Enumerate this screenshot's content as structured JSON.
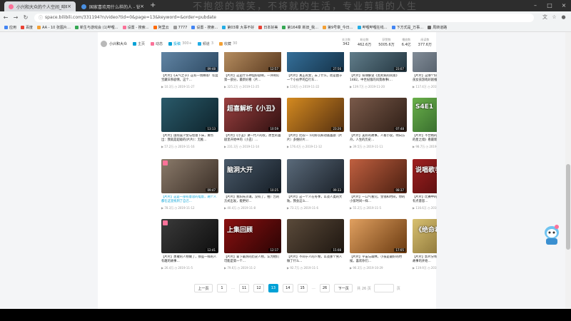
{
  "browser": {
    "tabs": [
      {
        "title": "小兴和大众的个人空间_哔哩哔哩",
        "active": true
      },
      {
        "title": "国家喜欢用什么样的人 - 钻石…",
        "active": false
      }
    ],
    "url": "space.bilibili.com/331194?n/video?tid=0&page=13&keyword=&order=pubdate",
    "overlay_text": "不抱怨的微笑，不将就的生活，专业剪辑的人生"
  },
  "bookmarks": [
    "应用",
    "百度",
    "AA - 10 张图片…",
    "新生与游戏会 (1)哔哩…",
    "设置 - 搜索…",
    "阿里云",
    "7777",
    "设置 - 搜索…",
    "第03章 大事不好",
    "日本好美",
    "第164章 新旧_我…",
    "第9号章_今日…",
    "哔哩哔哩在线…",
    "下方式是_万事…",
    "周转道路"
  ],
  "user": {
    "name": "小兴和大众",
    "tabs": [
      {
        "label": "主页",
        "count": ""
      },
      {
        "label": "动态",
        "count": ""
      },
      {
        "label": "投稿",
        "count": "300+"
      },
      {
        "label": "频道",
        "count": "3"
      },
      {
        "label": "收藏",
        "count": "30"
      }
    ],
    "stats": [
      {
        "label": "关注数",
        "value": "342"
      },
      {
        "label": "粉丝数",
        "value": "462.6万"
      },
      {
        "label": "获赞数",
        "value": "5005.6万"
      },
      {
        "label": "播放数",
        "value": "6.4亿"
      },
      {
        "label": "阅读数",
        "value": "377.6万"
      }
    ]
  },
  "videos": [
    {
      "title": "【片片】《天气之子》这有一场降雨！年度宝藏日系剧情，这个…",
      "views": "10.3万",
      "date": "2019-11-27",
      "duration": "09:48",
      "thumb_text": "",
      "c1": "#6a8fb0",
      "c2": "#2e4a63"
    },
    {
      "title": "【片片】这是什么神仙好剧啊，一评奇幻第一部分，最新好看（片…",
      "views": "325.2万",
      "date": "2019-11-25",
      "duration": "12:57",
      "thumb_text": "",
      "c1": "#c59b6a",
      "c2": "#5a3a20"
    },
    {
      "title": "【片片】真正的女，去了什么，而是由于一个小伙伴的自行车…",
      "views": "116万",
      "date": "2019-11-22",
      "duration": "27:56",
      "thumb_text": "时间旅行",
      "c1": "#3a7aa8",
      "c2": "#153248"
    },
    {
      "title": "【片片】排球解读《黑死病的风景》1482，中世纪版的风景故事(…",
      "views": "139.7万",
      "date": "2019-11-20",
      "duration": "23:07",
      "thumb_text": "",
      "c1": "#6c8a98",
      "c2": "#243640"
    },
    {
      "title": "【片片】这哪个好剧是给你解决一个大男孩女孩游戏好剧推荐…",
      "views": "117.4万",
      "date": "2019-11-18",
      "duration": "11:36",
      "thumb_text": "",
      "c1": "#8f9aa5",
      "c2": "#3a4450"
    },
    {
      "title": "【片片】国际美少女与怪兽下床，要点出：我就是超级的(片片)：无推…",
      "views": "57.2万",
      "date": "2019-11-16",
      "duration": "13:13",
      "thumb_text": "",
      "c1": "#2a5a6a",
      "c2": "#0e242c"
    },
    {
      "title": "【片片】《小丑》讲一代人的欢，原生的喜剧里开始中的（小丑）…",
      "views": "231.3万",
      "date": "2019-11-14",
      "duration": "10:59",
      "thumb_text": "超喜解析《小丑》",
      "c1": "#9a4040",
      "c2": "#301010"
    },
    {
      "title": "【片片】比较一下的好玩和动画喜剧（片片）多维好片…",
      "views": "176.4万",
      "date": "2019-11-12",
      "duration": "23:26",
      "thumb_text": "",
      "c1": "#d48a20",
      "c2": "#553010"
    },
    {
      "title": "【片片】美好的故事，人看小说，明日方舟，人生的历史…",
      "views": "39.5万",
      "date": "2019-11-11",
      "duration": "07:48",
      "thumb_text": "",
      "c1": "#7a5a4a",
      "c2": "#2e1e16"
    },
    {
      "title": "【片片】不合格的，那些被喜欢的《神秘的星之境》看最新…",
      "views": "98.7万",
      "date": "2019-11-10",
      "duration": "16:40",
      "thumb_text": "S4E1",
      "c1": "#6ab04a",
      "c2": "#1e4a20"
    },
    {
      "title": "【片片】这是一部有意思的电影，两个人都在这里找到了自己…",
      "views": "78.3万",
      "date": "2019-11-12",
      "duration": "09:47",
      "thumb_text": "",
      "c1": "#8a7a6a",
      "c2": "#3a2e26"
    },
    {
      "title": "【片片】我阳光沙滩，没有了，拍广告的方式出发，能更好…",
      "views": "40.4万",
      "date": "2019-11-8",
      "duration": "10:25",
      "thumb_text": "脑洞大开",
      "c1": "#4a5a6a",
      "c2": "#141c24"
    },
    {
      "title": "【片片】这一个人在冬季，以及人类的大陆，我会这么…",
      "views": "73.1万",
      "date": "2019-11-6",
      "duration": "09:33",
      "thumb_text": "",
      "c1": "#5a6a7a",
      "c2": "#1a2028"
    },
    {
      "title": "【片片】一口气看完，金钱和时间，你的小孩时间一样…",
      "views": "55.2万",
      "date": "2019-11-5",
      "duration": "08:37",
      "thumb_text": "",
      "c1": "#c06040",
      "c2": "#4a1e10"
    },
    {
      "title": "【片片】比赛中的歌手和最后一次对决，有点意思…",
      "views": "116.6万",
      "date": "2019-11-6",
      "duration": "13:08",
      "thumb_text": "说唱歌手",
      "c1": "#a02020",
      "c2": "#3a0808"
    },
    {
      "title": "【片片】勇敢的人物做了，那些一样的人有趣的故事…",
      "views": "26.4万",
      "date": "2019-11-5",
      "duration": "12:41",
      "thumb_text": "",
      "c1": "#3a3a3a",
      "c2": "#0e0e0e"
    },
    {
      "title": "【片片】拿下最热的历史人物，认为他们可能是第一个…",
      "views": "79.6万",
      "date": "2019-11-2",
      "duration": "12:17",
      "thumb_text": "上集回顾",
      "c1": "#8a1010",
      "c2": "#2a0404"
    },
    {
      "title": "【片片】不同于人的人物，以及那个男人做了什么…",
      "views": "92.7万",
      "date": "2019-11-1",
      "duration": "15:08",
      "thumb_text": "",
      "c1": "#5a4a3a",
      "c2": "#1e1610"
    },
    {
      "title": "【片片】宇宙与森林，小孩是最好的时候，喜欢你们…",
      "views": "96.3万",
      "date": "2019-10-29",
      "duration": "17:05",
      "thumb_text": "",
      "c1": "#e0a060",
      "c2": "#6a3a10"
    },
    {
      "title": "【片片】影片分析《绝命毒师》第一季，故事的开始…",
      "views": "119.9万",
      "date": "2019-10-26",
      "duration": "25:14",
      "thumb_text": "《绝命毒师》",
      "c1": "#d8c070",
      "c2": "#6a5420"
    }
  ],
  "pagination": {
    "prev": "上一页",
    "pages": [
      "1",
      "11",
      "12",
      "13",
      "14",
      "15"
    ],
    "current": "13",
    "last": "26",
    "next": "下一页",
    "total": "共 26 页",
    "goto": "页"
  },
  "colors": {
    "accent": "#00a1d6",
    "pink": "#fb7299"
  }
}
